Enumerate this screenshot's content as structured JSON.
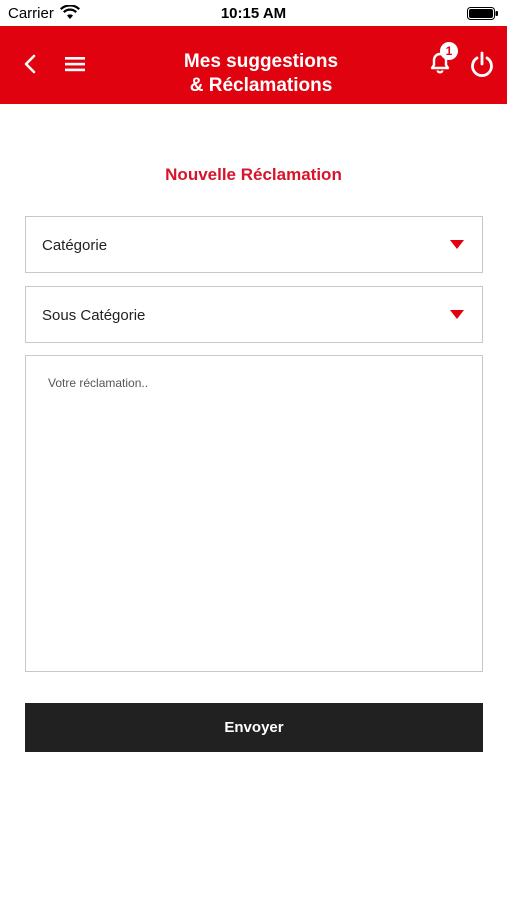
{
  "status_bar": {
    "carrier": "Carrier",
    "time": "10:15 AM",
    "wifi_icon": "wifi-icon",
    "battery_icon": "battery-icon"
  },
  "header": {
    "title_line1": "Mes suggestions",
    "title_line2": "& Réclamations",
    "notification_count": "1",
    "background_color": "#e0030f",
    "icons": [
      "chevron-left-icon",
      "hamburger-menu-icon",
      "bell-icon",
      "power-icon"
    ]
  },
  "form": {
    "title": "Nouvelle Réclamation",
    "category_label": "Catégorie",
    "subcategory_label": "Sous Catégorie",
    "message_placeholder": "Votre réclamation..",
    "submit_label": "Envoyer",
    "accent_color": "#d7142b",
    "button_color": "#212121"
  }
}
